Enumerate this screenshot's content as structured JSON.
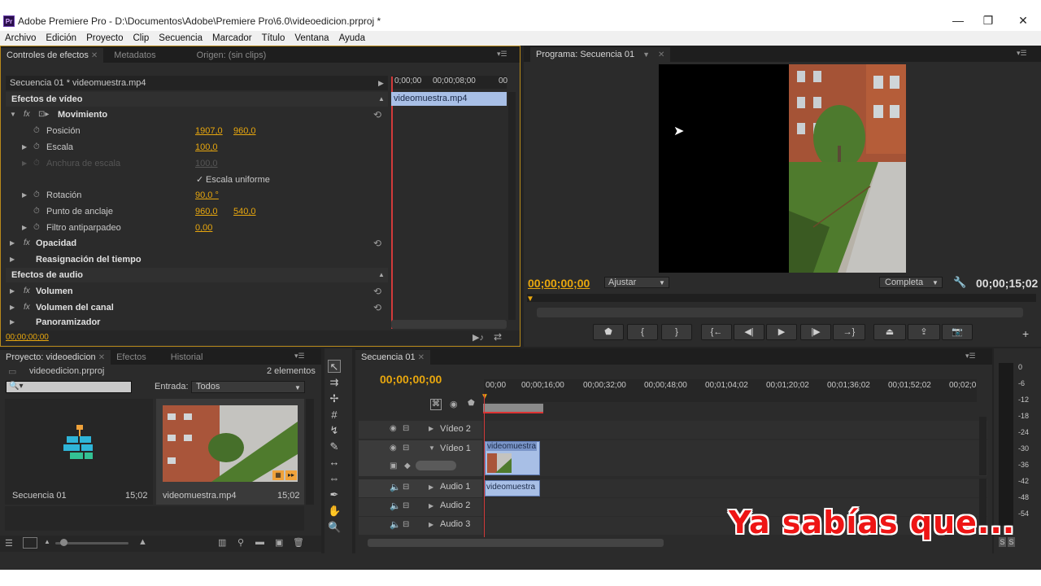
{
  "window": {
    "app_icon": "Pr",
    "title": "Adobe Premiere Pro - D:\\Documentos\\Adobe\\Premiere Pro\\6.0\\videoedicion.prproj *",
    "minimize": "—",
    "restore": "❐",
    "close": "✕"
  },
  "menu": [
    "Archivo",
    "Edición",
    "Proyecto",
    "Clip",
    "Secuencia",
    "Marcador",
    "Título",
    "Ventana",
    "Ayuda"
  ],
  "effect_controls": {
    "tabs": [
      "Controles de efectos",
      "Metadatos",
      "Origen: (sin clips)"
    ],
    "sequence_label": "Secuencia 01 * videomuestra.mp4",
    "ruler": [
      "0;00;00",
      "00;00;08;00",
      "00"
    ],
    "clip_name": "videomuestra.mp4",
    "video_effects": "Efectos de vídeo",
    "movement": "Movimiento",
    "position": {
      "label": "Posición",
      "x": "1907,0",
      "y": "960,0"
    },
    "scale": {
      "label": "Escala",
      "value": "100,0"
    },
    "scale_width": {
      "label": "Anchura de escala",
      "value": "100,0"
    },
    "uniform_scale": "Escala uniforme",
    "rotation": {
      "label": "Rotación",
      "value": "90,0 °"
    },
    "anchor": {
      "label": "Punto de anclaje",
      "x": "960,0",
      "y": "540,0"
    },
    "flicker": {
      "label": "Filtro antiparpadeo",
      "value": "0,00"
    },
    "opacity": "Opacidad",
    "time_remap": "Reasignación del tiempo",
    "audio_effects": "Efectos de audio",
    "volume": "Volumen",
    "channel_volume": "Volumen del canal",
    "panner": "Panoramizador",
    "timecode": "00;00;00;00"
  },
  "program": {
    "tab": "Programa: Secuencia 01",
    "timecode_left": "00;00;00;00",
    "fit": "Ajustar",
    "quality": "Completa",
    "timecode_right": "00;00;15;02"
  },
  "project": {
    "tabs": [
      "Proyecto: videoedicion",
      "Efectos",
      "Historial"
    ],
    "filename": "videoedicion.prproj",
    "count": "2 elementos",
    "entry_label": "Entrada:",
    "entry_value": "Todos",
    "items": [
      {
        "name": "Secuencia 01",
        "duration": "15;02"
      },
      {
        "name": "videomuestra.mp4",
        "duration": "15;02"
      }
    ]
  },
  "timeline": {
    "tab": "Secuencia 01",
    "timecode": "00;00;00;00",
    "ruler": [
      "00;00",
      "00;00;16;00",
      "00;00;32;00",
      "00;00;48;00",
      "00;01;04;02",
      "00;01;20;02",
      "00;01;36;02",
      "00;01;52;02",
      "00;02;0"
    ],
    "tracks": {
      "v2": "Vídeo 2",
      "v1": "Vídeo 1",
      "a1": "Audio 1",
      "a2": "Audio 2",
      "a3": "Audio 3"
    },
    "clip_video": "videomuestra",
    "clip_audio": "videomuestra"
  },
  "meter": {
    "scale": [
      "0",
      "-6",
      "-12",
      "-18",
      "-24",
      "-30",
      "-36",
      "-42",
      "-48",
      "-54"
    ],
    "solo_left": "S",
    "solo_right": "S"
  },
  "overlay_text": "Ya sabías que...",
  "colors": {
    "accent_orange": "#e8a70e",
    "panel_bg": "#2b2b2b",
    "clip_blue": "#8fa9d6",
    "overlay_red": "#ee1515"
  }
}
